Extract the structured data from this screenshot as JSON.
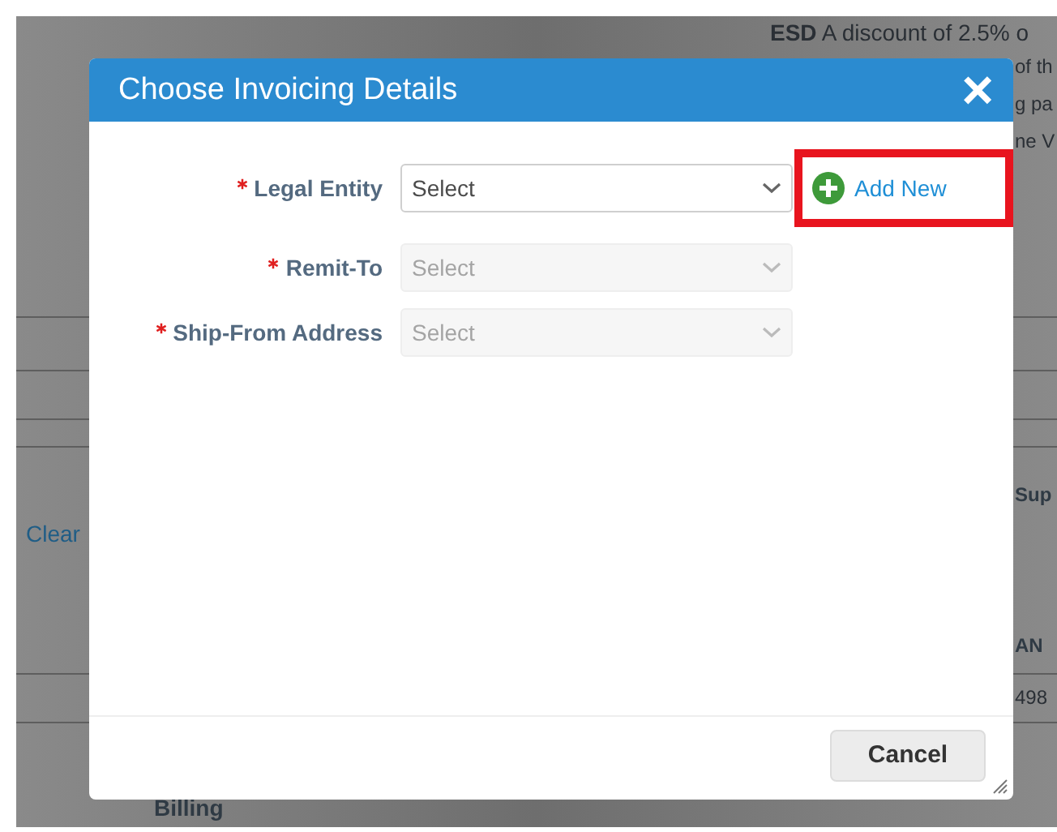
{
  "background": {
    "fragments": [
      {
        "kind": "text",
        "text": "**ESD** A discount of 2.5% o"
      },
      {
        "kind": "text",
        "text": "of th"
      },
      {
        "kind": "text",
        "text": "g pa"
      },
      {
        "kind": "text",
        "text": "ne V"
      },
      {
        "kind": "heading",
        "text": "Sup"
      },
      {
        "kind": "link",
        "text": "Clear"
      },
      {
        "kind": "heading",
        "text": "AN"
      },
      {
        "kind": "text",
        "text": "498"
      },
      {
        "kind": "heading",
        "text": "Billing"
      }
    ]
  },
  "dialog": {
    "title": "Choose Invoicing Details",
    "close": "×",
    "fields": [
      {
        "label": "Legal Entity",
        "required": true,
        "placeholder": "Select",
        "disabled": false
      },
      {
        "label": "Remit-To",
        "required": true,
        "placeholder": "Select",
        "disabled": true
      },
      {
        "label": "Ship-From Address",
        "required": true,
        "placeholder": "Select",
        "disabled": true
      }
    ],
    "add_new": {
      "label": "Add New",
      "highlighted": true
    },
    "buttons": [
      "Cancel"
    ]
  }
}
